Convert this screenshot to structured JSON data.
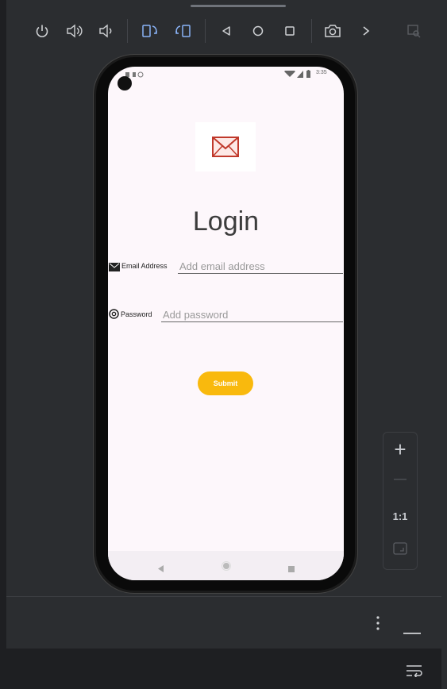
{
  "toolbar": {
    "buttons": [
      "power-icon",
      "volume-up-icon",
      "volume-down-icon",
      "rotate-left-icon",
      "rotate-right-icon",
      "back-icon",
      "home-icon",
      "overview-icon",
      "camera-icon",
      "more-icon",
      "snapshot-icon"
    ]
  },
  "login": {
    "title": "Login",
    "email_label": "Email Address",
    "email_placeholder": "Add email address",
    "password_label": "Password",
    "password_placeholder": "Add password",
    "submit_label": "Submit"
  },
  "status": {
    "time": "3:35"
  },
  "zoom": {
    "plus": "+",
    "minus": "—",
    "actual": "1:1"
  },
  "colors": {
    "accent": "#f9b90d",
    "screen_bg": "#fdf7fb",
    "ide_bg": "#2b2d30",
    "mail_icon": "#c0392b"
  }
}
